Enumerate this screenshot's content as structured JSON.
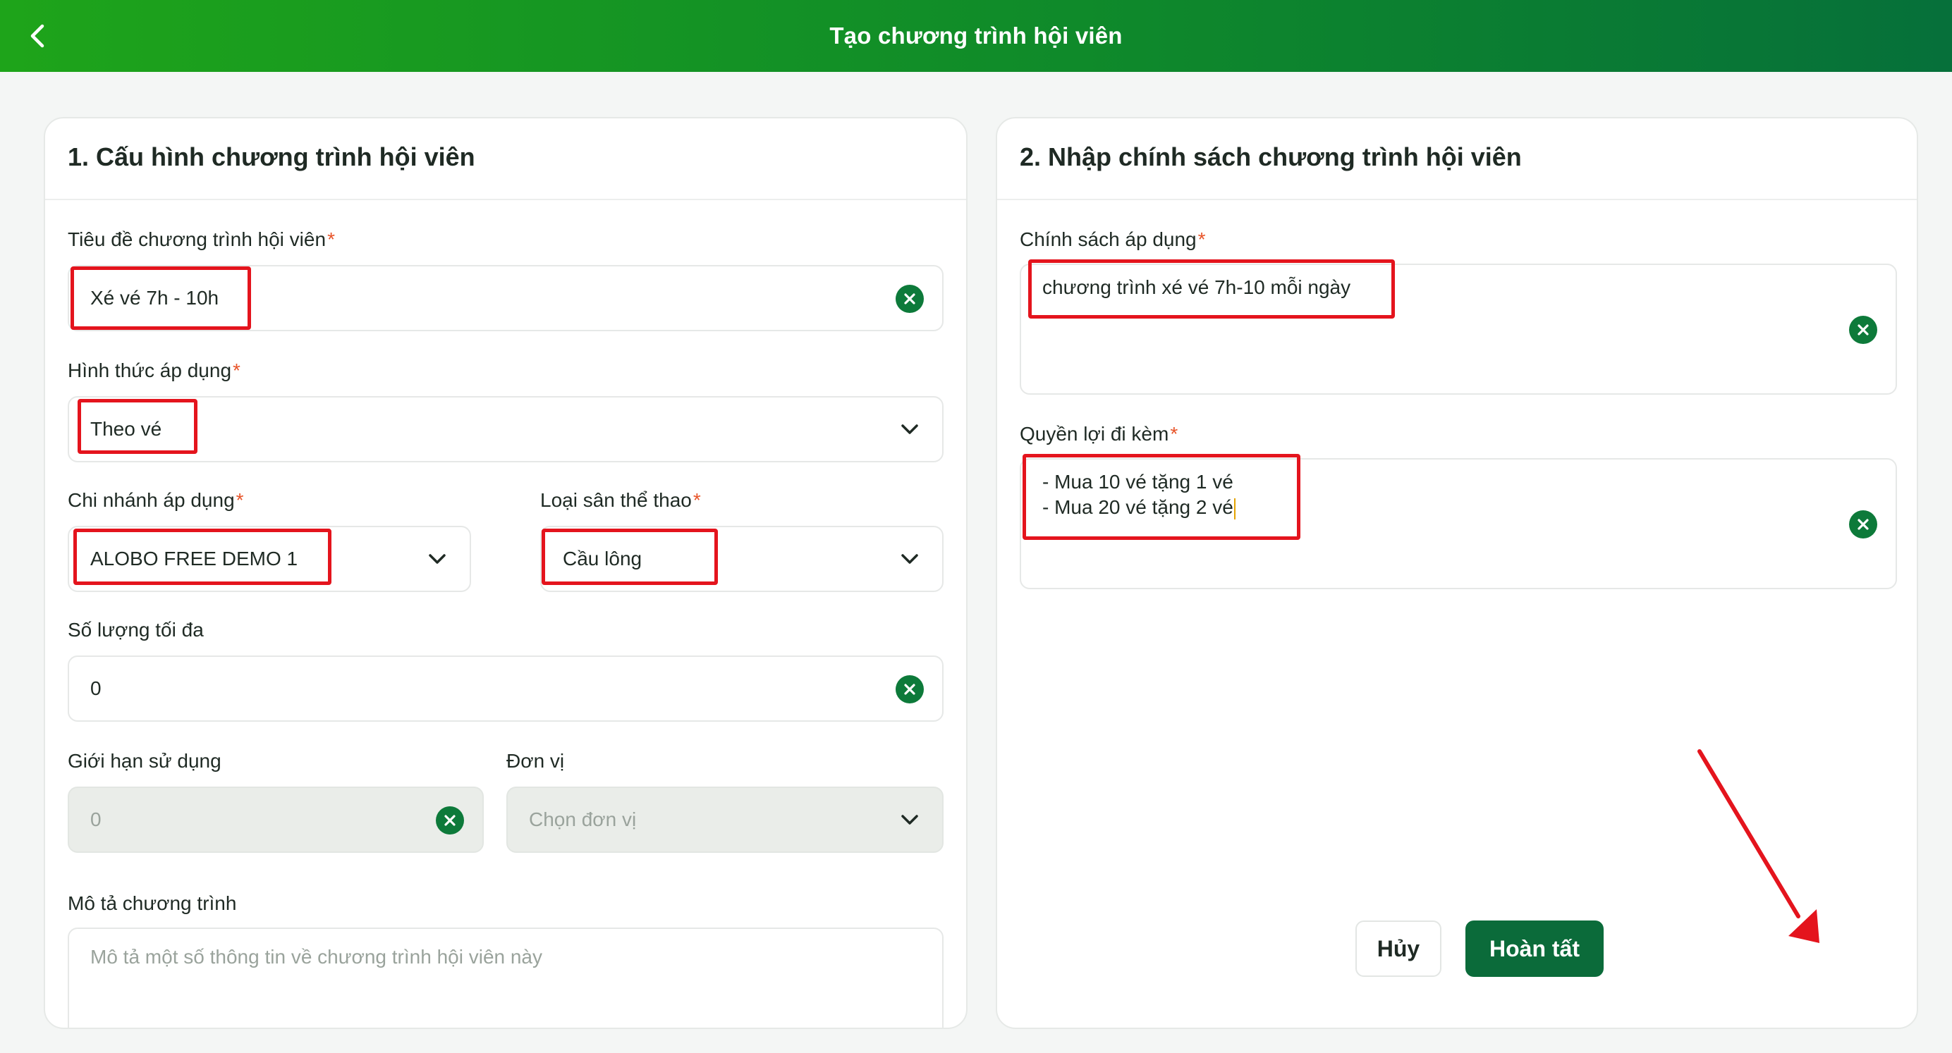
{
  "header": {
    "title": "Tạo chương trình hội viên"
  },
  "config": {
    "title": "1. Cấu hình chương trình hội viên",
    "program_title": {
      "label": "Tiêu đề chương trình hội viên",
      "value": "Xé vé 7h - 10h"
    },
    "apply_form": {
      "label": "Hình thức áp dụng",
      "value": "Theo vé"
    },
    "branch": {
      "label": "Chi nhánh áp dụng",
      "value": "ALOBO FREE DEMO 1"
    },
    "sport_type": {
      "label": "Loại sân thể thao",
      "value": "Cầu lông"
    },
    "max_quantity": {
      "label": "Số lượng tối đa",
      "value": "0"
    },
    "usage_limit": {
      "label": "Giới hạn sử dụng",
      "value": "0"
    },
    "unit": {
      "label": "Đơn vị",
      "placeholder": "Chọn đơn vị"
    },
    "description": {
      "label": "Mô tả chương trình",
      "placeholder": "Mô tả một số thông tin về chương trình hội viên này"
    }
  },
  "policy": {
    "title": "2. Nhập chính sách chương trình hội viên",
    "applied_policy": {
      "label": "Chính sách áp dụng",
      "value": "chương trình xé vé 7h-10 mỗi ngày"
    },
    "benefits": {
      "label": "Quyền lợi đi kèm",
      "line1": "- Mua 10 vé tặng 1 vé",
      "line2": "- Mua 20 vé tặng 2 vé"
    }
  },
  "actions": {
    "cancel": "Hủy",
    "done": "Hoàn tất"
  },
  "required_mark": "*",
  "colors": {
    "header_start": "#1ea41a",
    "header_end": "#06703a",
    "primary": "#0b6b3a",
    "highlight": "#e4141d",
    "required": "#e8552a"
  },
  "icons": {
    "back": "chevron-left-icon",
    "clear": "clear-circle-icon",
    "dropdown": "chevron-down-icon",
    "annotation": "red-arrow-annotation"
  }
}
